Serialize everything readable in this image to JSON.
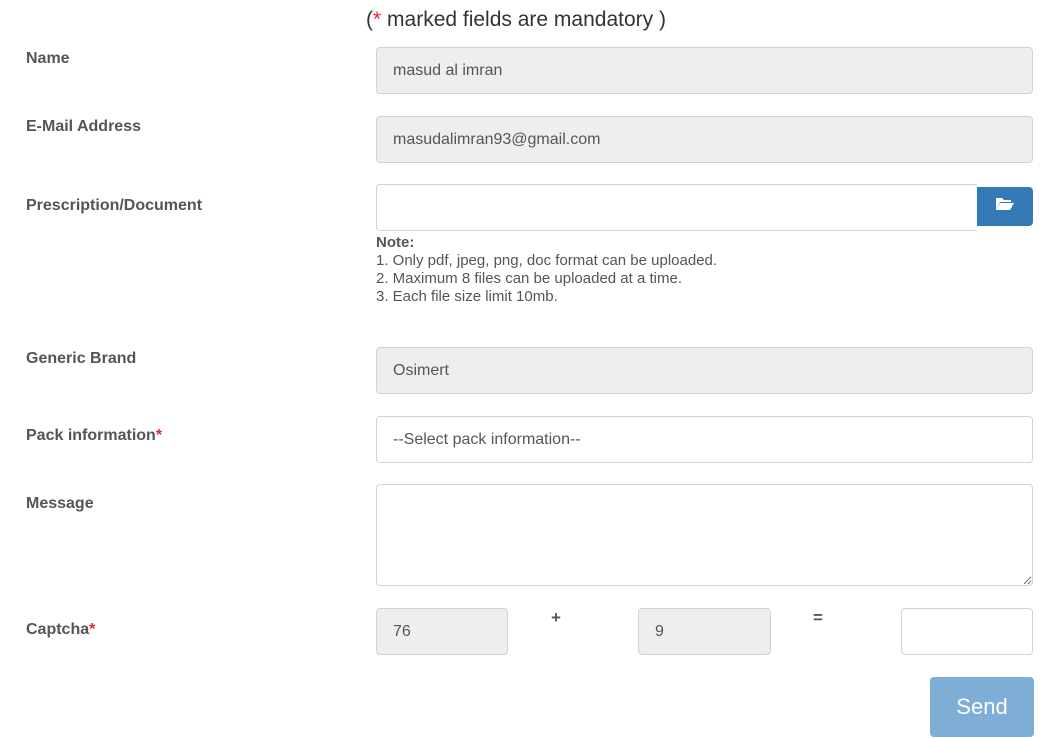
{
  "form": {
    "mandatory_note_open": "(",
    "mandatory_note_star": "*",
    "mandatory_note_text": " marked fields are mandatory )",
    "name": {
      "label": "Name",
      "value": "masud al imran"
    },
    "email": {
      "label": "E-Mail Address",
      "value": "masudalimran93@gmail.com"
    },
    "document": {
      "label": "Prescription/Document",
      "browse_icon": "folder-open-icon",
      "note_title": "Note:",
      "note_lines": [
        "1. Only pdf, jpeg, png, doc format can be uploaded.",
        "2. Maximum 8 files can be uploaded at a time.",
        "3. Each file size limit 10mb."
      ]
    },
    "generic_brand": {
      "label": "Generic Brand",
      "value": "Osimert"
    },
    "pack_information": {
      "label": "Pack information",
      "required_mark": "*",
      "selected": "--Select pack information--"
    },
    "message": {
      "label": "Message",
      "value": ""
    },
    "captcha": {
      "label": "Captcha",
      "required_mark": "*",
      "operand_a": "76",
      "operator": "+",
      "operand_b": "9",
      "equals": "=",
      "answer": ""
    },
    "send_label": "Send"
  },
  "colors": {
    "required": "#e3262d",
    "browse_button": "#337ab7",
    "send_button": "#7eaed6",
    "readonly_bg": "#eeeeee"
  }
}
